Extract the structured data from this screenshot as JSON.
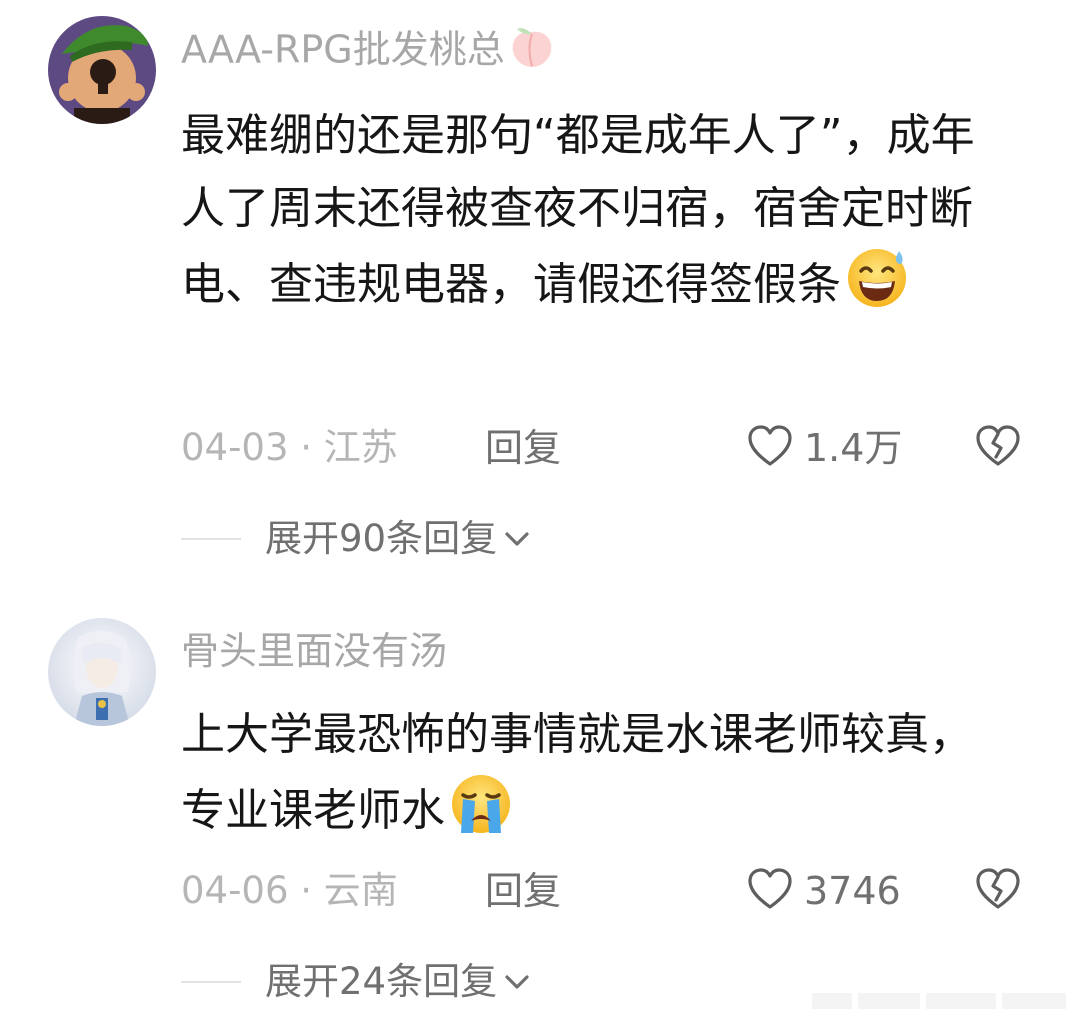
{
  "comments": [
    {
      "username": "AAA-RPG批发桃总",
      "badge_icon": "peach-badge-icon",
      "text": "最难绷的还是那句“都是成年人了”，成年人了周末还得被查夜不归宿，宿舍定时断电、查违规电器，请假还得签假条",
      "emoji_icon": "grinning-sweat-emoji",
      "date_location": "04-03 · 江苏",
      "reply_label": "回复",
      "likes": "1.4万",
      "expand_label": "展开90条回复"
    },
    {
      "username": "骨头里面没有汤",
      "text": "上大学最恐怖的事情就是水课老师较真，专业课老师水",
      "emoji_icon": "crying-face-emoji",
      "date_location": "04-06 · 云南",
      "reply_label": "回复",
      "likes": "3746",
      "expand_label": "展开24条回复"
    }
  ],
  "colors": {
    "username": "#a7a7a7",
    "body_text": "#161616",
    "meta_text": "#b5b5b5",
    "action_text": "#707070",
    "divider": "#e3e3e3"
  }
}
